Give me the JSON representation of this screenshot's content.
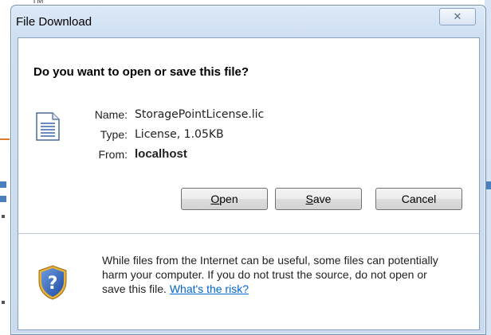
{
  "background": {
    "tm": "TM"
  },
  "window": {
    "title": "File Download",
    "close_glyph": "✕"
  },
  "dialog": {
    "question": "Do you want to open or save this file?",
    "file_icon": "document-icon",
    "fields": {
      "name_label": "Name:",
      "name_value": "StoragePointLicense.lic",
      "type_label": "Type:",
      "type_value": "License, 1.05KB",
      "from_label": "From:",
      "from_value": "localhost"
    },
    "buttons": {
      "open": {
        "mnemonic": "O",
        "rest": "pen"
      },
      "save": {
        "mnemonic": "S",
        "rest": "ave"
      },
      "cancel": "Cancel"
    },
    "warning": {
      "icon": "shield-question-icon",
      "text": "While files from the Internet can be useful, some files can potentially harm your computer. If you do not trust the source, do not open or save this file.",
      "link": "What's the risk?"
    }
  },
  "colors": {
    "frame": "#cfdff2",
    "link": "#0066cc",
    "shield_blue": "#2a5db0",
    "shield_gold": "#e8b23a"
  }
}
